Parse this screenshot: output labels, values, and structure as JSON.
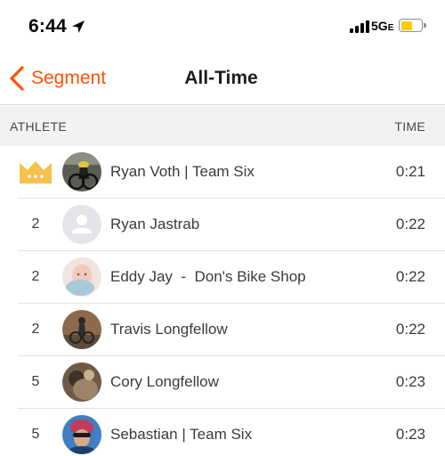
{
  "status_bar": {
    "time": "6:44",
    "network": "5G",
    "network_suffix": "E",
    "battery_level": 0.55,
    "battery_color": "#ffcc00"
  },
  "nav": {
    "back_label": "Segment",
    "title": "All-Time",
    "accent_color": "#fc5200"
  },
  "table": {
    "athlete_header": "ATHLETE",
    "time_header": "TIME",
    "rows": [
      {
        "rank": "",
        "rank_icon": "crown-icon",
        "avatar": "rider-photo",
        "name": "Ryan Voth | Team Six",
        "time": "0:21"
      },
      {
        "rank": "2",
        "avatar": "default-avatar",
        "name": "Ryan Jastrab",
        "time": "0:22"
      },
      {
        "rank": "2",
        "avatar": "baby-photo",
        "name": "Eddy Jay  -  Don's Bike Shop",
        "time": "0:22"
      },
      {
        "rank": "2",
        "avatar": "rider-photo",
        "name": "Travis Longfellow",
        "time": "0:22"
      },
      {
        "rank": "5",
        "avatar": "portrait-photo",
        "name": "Cory Longfellow",
        "time": "0:23"
      },
      {
        "rank": "5",
        "avatar": "helmet-photo",
        "name": "Sebastian | Team Six",
        "time": "0:23"
      }
    ]
  }
}
